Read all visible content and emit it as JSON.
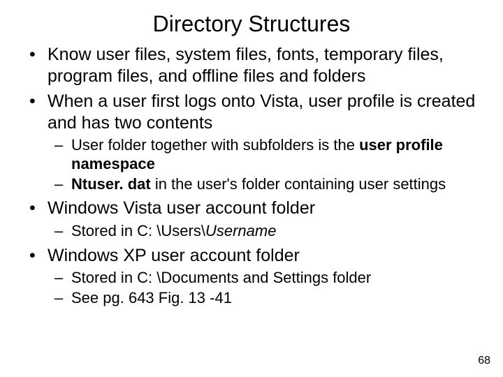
{
  "title": "Directory Structures",
  "bullets": {
    "b0": "Know user files, system files, fonts, temporary files, program files, and offline files and folders",
    "b1": "When a user first logs onto Vista, user profile is created and has two contents",
    "b1_sub": {
      "s0_pre": "User folder together with subfolders is the ",
      "s0_bold": "user profile namespace",
      "s1_bold": "Ntuser. dat",
      "s1_rest": " in the user's folder containing user settings"
    },
    "b2": "Windows Vista user account folder",
    "b2_sub": {
      "s0_pre": "Stored in C: \\Users\\",
      "s0_it": "Username"
    },
    "b3": "Windows XP user account folder",
    "b3_sub": {
      "s0": "Stored in C: \\Documents and Settings folder",
      "s1": "See pg. 643 Fig. 13 -41"
    }
  },
  "page_number": "68"
}
